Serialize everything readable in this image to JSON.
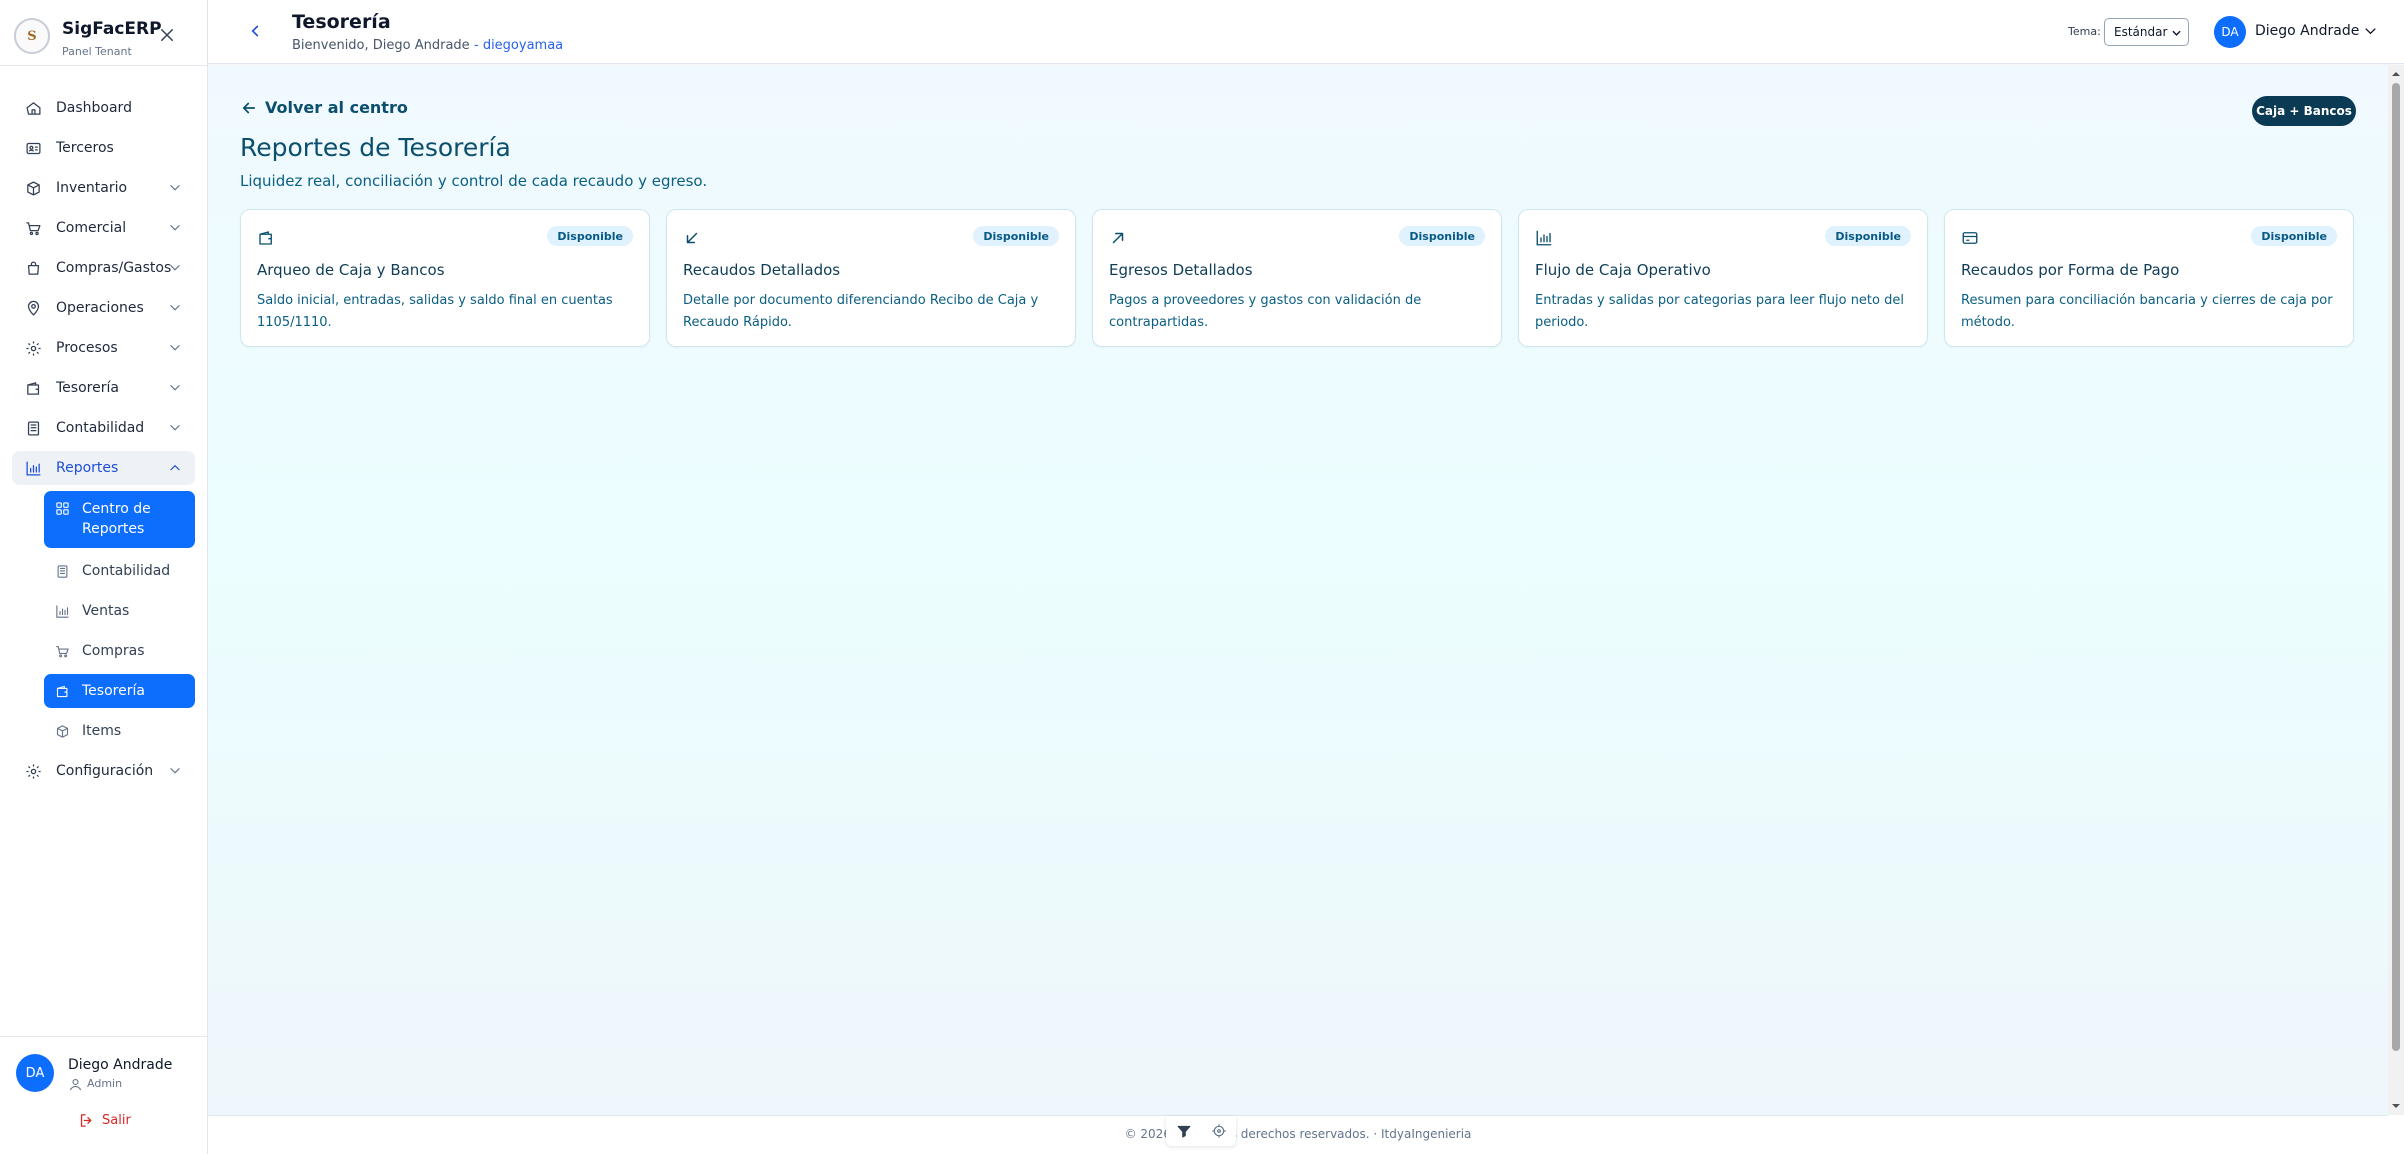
{
  "brand": {
    "name": "SigFacERP",
    "subtitle": "Panel Tenant",
    "logo_text": "S"
  },
  "sidebar": {
    "items": [
      {
        "label": "Dashboard",
        "icon": "home-icon"
      },
      {
        "label": "Terceros",
        "icon": "id-card-icon"
      },
      {
        "label": "Inventario",
        "icon": "box-icon"
      },
      {
        "label": "Comercial",
        "icon": "cart-icon"
      },
      {
        "label": "Compras/Gastos",
        "icon": "bag-icon"
      },
      {
        "label": "Operaciones",
        "icon": "location-pin-icon"
      },
      {
        "label": "Procesos",
        "icon": "gear-icon"
      },
      {
        "label": "Tesorería",
        "icon": "wallet-icon"
      },
      {
        "label": "Contabilidad",
        "icon": "ledger-icon"
      },
      {
        "label": "Reportes",
        "icon": "bar-chart-icon"
      },
      {
        "label": "Configuración",
        "icon": "gear-icon"
      }
    ],
    "reportes_sub": [
      {
        "label": "Centro de Reportes",
        "icon": "grid-icon"
      },
      {
        "label": "Contabilidad",
        "icon": "ledger-icon"
      },
      {
        "label": "Ventas",
        "icon": "bar-chart-icon"
      },
      {
        "label": "Compras",
        "icon": "cart-icon"
      },
      {
        "label": "Tesorería",
        "icon": "wallet-icon"
      },
      {
        "label": "Items",
        "icon": "box-icon"
      }
    ],
    "footer": {
      "initials": "DA",
      "name": "Diego Andrade",
      "role": "Admin",
      "logout": "Salir"
    }
  },
  "header": {
    "title": "Tesorería",
    "welcome": "Bienvenido, Diego Andrade",
    "username": "- diegoyamaa",
    "theme_label": "Tema:",
    "theme_value": "Estándar",
    "user_initials": "DA",
    "user_name": "Diego Andrade"
  },
  "main": {
    "back_link": "Volver al centro",
    "tag": "Caja + Bancos",
    "title": "Reportes de Tesorería",
    "subtitle": "Liquidez real, conciliación y control de cada recaudo y egreso.",
    "cards": [
      {
        "icon": "wallet-icon",
        "badge": "Disponible",
        "title": "Arqueo de Caja y Bancos",
        "description": "Saldo inicial, entradas, salidas y saldo final en cuentas 1105/1110."
      },
      {
        "icon": "arrow-down-left-icon",
        "badge": "Disponible",
        "title": "Recaudos Detallados",
        "description": "Detalle por documento diferenciando Recibo de Caja y Recaudo Rápido."
      },
      {
        "icon": "arrow-up-right-icon",
        "badge": "Disponible",
        "title": "Egresos Detallados",
        "description": "Pagos a proveedores y gastos con validación de contrapartidas."
      },
      {
        "icon": "bar-chart-icon",
        "badge": "Disponible",
        "title": "Flujo de Caja Operativo",
        "description": "Entradas y salidas por categorias para leer flujo neto del periodo."
      },
      {
        "icon": "credit-card-icon",
        "badge": "Disponible",
        "title": "Recaudos por Forma de Pago",
        "description": "Resumen para conciliación bancaria y cierres de caja por método."
      }
    ]
  },
  "footer": {
    "text": "© 2026 · Todos los derechos reservados. · ItdyaIngenieria"
  },
  "colors": {
    "primary": "#0d6efd",
    "accent_dark": "#0b3a54",
    "text_teal": "#0b5f82",
    "badge_bg": "#e0f2fe",
    "danger": "#dc2626"
  }
}
